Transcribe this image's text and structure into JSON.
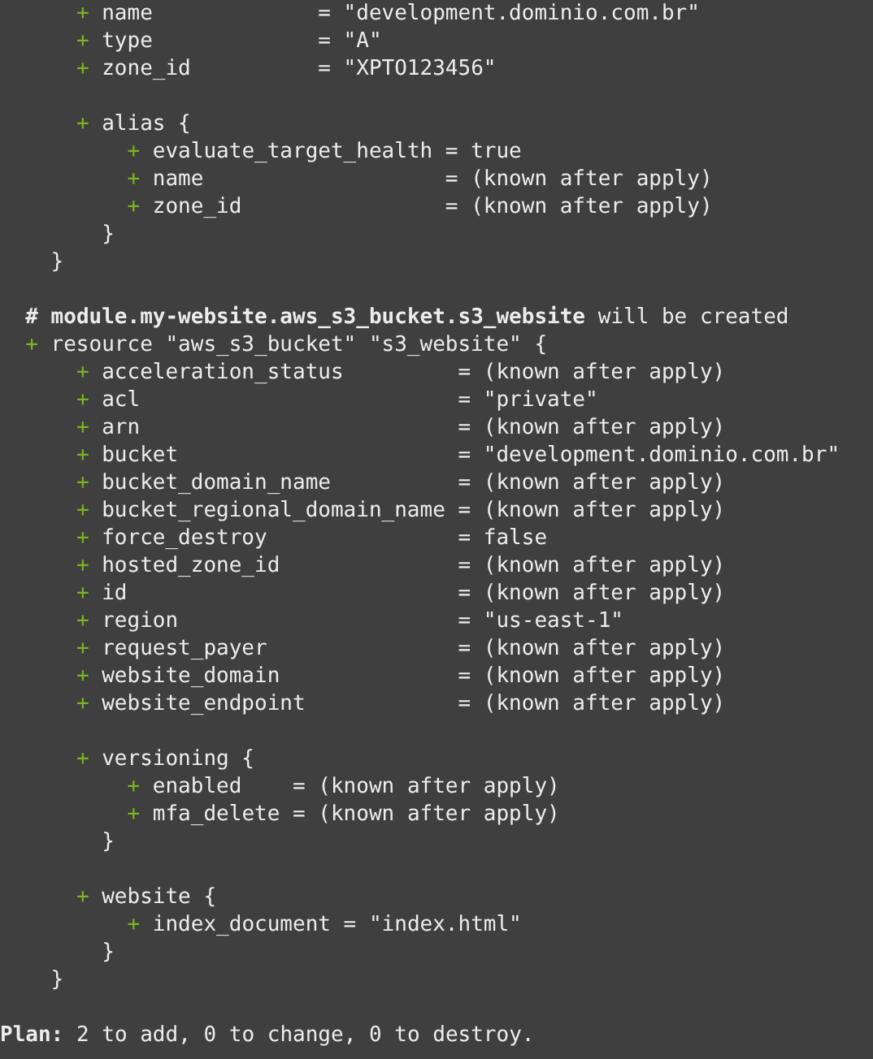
{
  "terminal": {
    "resources": [
      {
        "items": [
          {
            "kind": "attr",
            "marker": "+",
            "text": "name             = \"development.dominio.com.br\""
          },
          {
            "kind": "attr",
            "marker": "+",
            "text": "type             = \"A\""
          },
          {
            "kind": "attr",
            "marker": "+",
            "text": "zone_id          = \"XPTO123456\""
          },
          {
            "kind": "block",
            "marker": "+",
            "header": "alias {",
            "close": "}",
            "children": [
              {
                "kind": "attr",
                "marker": "+",
                "text": "evaluate_target_health = true"
              },
              {
                "kind": "attr",
                "marker": "+",
                "text": "name                   = (known after apply)"
              },
              {
                "kind": "attr",
                "marker": "+",
                "text": "zone_id                = (known after apply)"
              }
            ]
          }
        ],
        "close": "}"
      },
      {
        "comment": "**# module.my-website.aws_s3_bucket.s3_website** will be created",
        "marker": "+",
        "header": "resource \"aws_s3_bucket\" \"s3_website\" {",
        "items": [
          {
            "kind": "attr",
            "marker": "+",
            "text": "acceleration_status         = (known after apply)"
          },
          {
            "kind": "attr",
            "marker": "+",
            "text": "acl                         = \"private\""
          },
          {
            "kind": "attr",
            "marker": "+",
            "text": "arn                         = (known after apply)"
          },
          {
            "kind": "attr",
            "marker": "+",
            "text": "bucket                      = \"development.dominio.com.br\""
          },
          {
            "kind": "attr",
            "marker": "+",
            "text": "bucket_domain_name          = (known after apply)"
          },
          {
            "kind": "attr",
            "marker": "+",
            "text": "bucket_regional_domain_name = (known after apply)"
          },
          {
            "kind": "attr",
            "marker": "+",
            "text": "force_destroy               = false"
          },
          {
            "kind": "attr",
            "marker": "+",
            "text": "hosted_zone_id              = (known after apply)"
          },
          {
            "kind": "attr",
            "marker": "+",
            "text": "id                          = (known after apply)"
          },
          {
            "kind": "attr",
            "marker": "+",
            "text": "region                      = \"us-east-1\""
          },
          {
            "kind": "attr",
            "marker": "+",
            "text": "request_payer               = (known after apply)"
          },
          {
            "kind": "attr",
            "marker": "+",
            "text": "website_domain              = (known after apply)"
          },
          {
            "kind": "attr",
            "marker": "+",
            "text": "website_endpoint            = (known after apply)"
          },
          {
            "kind": "block",
            "marker": "+",
            "header": "versioning {",
            "close": "}",
            "children": [
              {
                "kind": "attr",
                "marker": "+",
                "text": "enabled    = (known after apply)"
              },
              {
                "kind": "attr",
                "marker": "+",
                "text": "mfa_delete = (known after apply)"
              }
            ]
          },
          {
            "kind": "block",
            "marker": "+",
            "header": "website {",
            "close": "}",
            "children": [
              {
                "kind": "attr",
                "marker": "+",
                "text": "index_document = \"index.html\""
              }
            ]
          }
        ],
        "close": "}"
      }
    ],
    "plan": "**Plan:** 2 to add, 0 to change, 0 to destroy."
  }
}
